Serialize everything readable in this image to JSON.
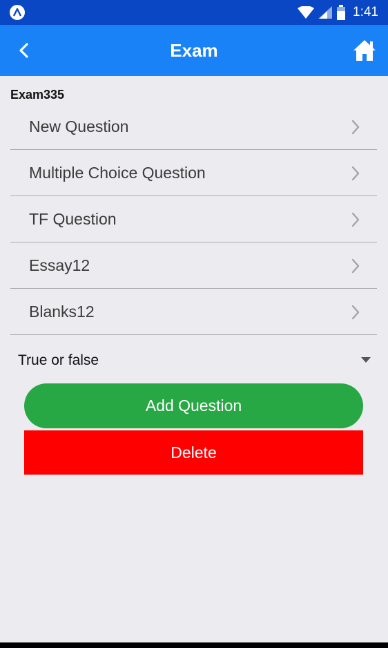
{
  "status_bar": {
    "time": "1:41",
    "icons": [
      "app-notification-icon",
      "wifi-icon",
      "cell-signal-icon",
      "battery-icon"
    ]
  },
  "nav": {
    "title": "Exam",
    "back_icon": "chevron-left-icon",
    "home_icon": "home-icon"
  },
  "exam": {
    "name": "Exam335"
  },
  "questions": [
    {
      "label": "New Question"
    },
    {
      "label": "Multiple Choice Question"
    },
    {
      "label": "TF Question"
    },
    {
      "label": "Essay12"
    },
    {
      "label": "Blanks12"
    }
  ],
  "question_type_select": {
    "value": "True or false"
  },
  "actions": {
    "add_label": "Add Question",
    "delete_label": "Delete"
  },
  "colors": {
    "status_bar": "#0a47c4",
    "nav_bar": "#1a82f7",
    "background": "#ebebf0",
    "add_button": "#28a745",
    "delete_button": "#ff0000"
  }
}
